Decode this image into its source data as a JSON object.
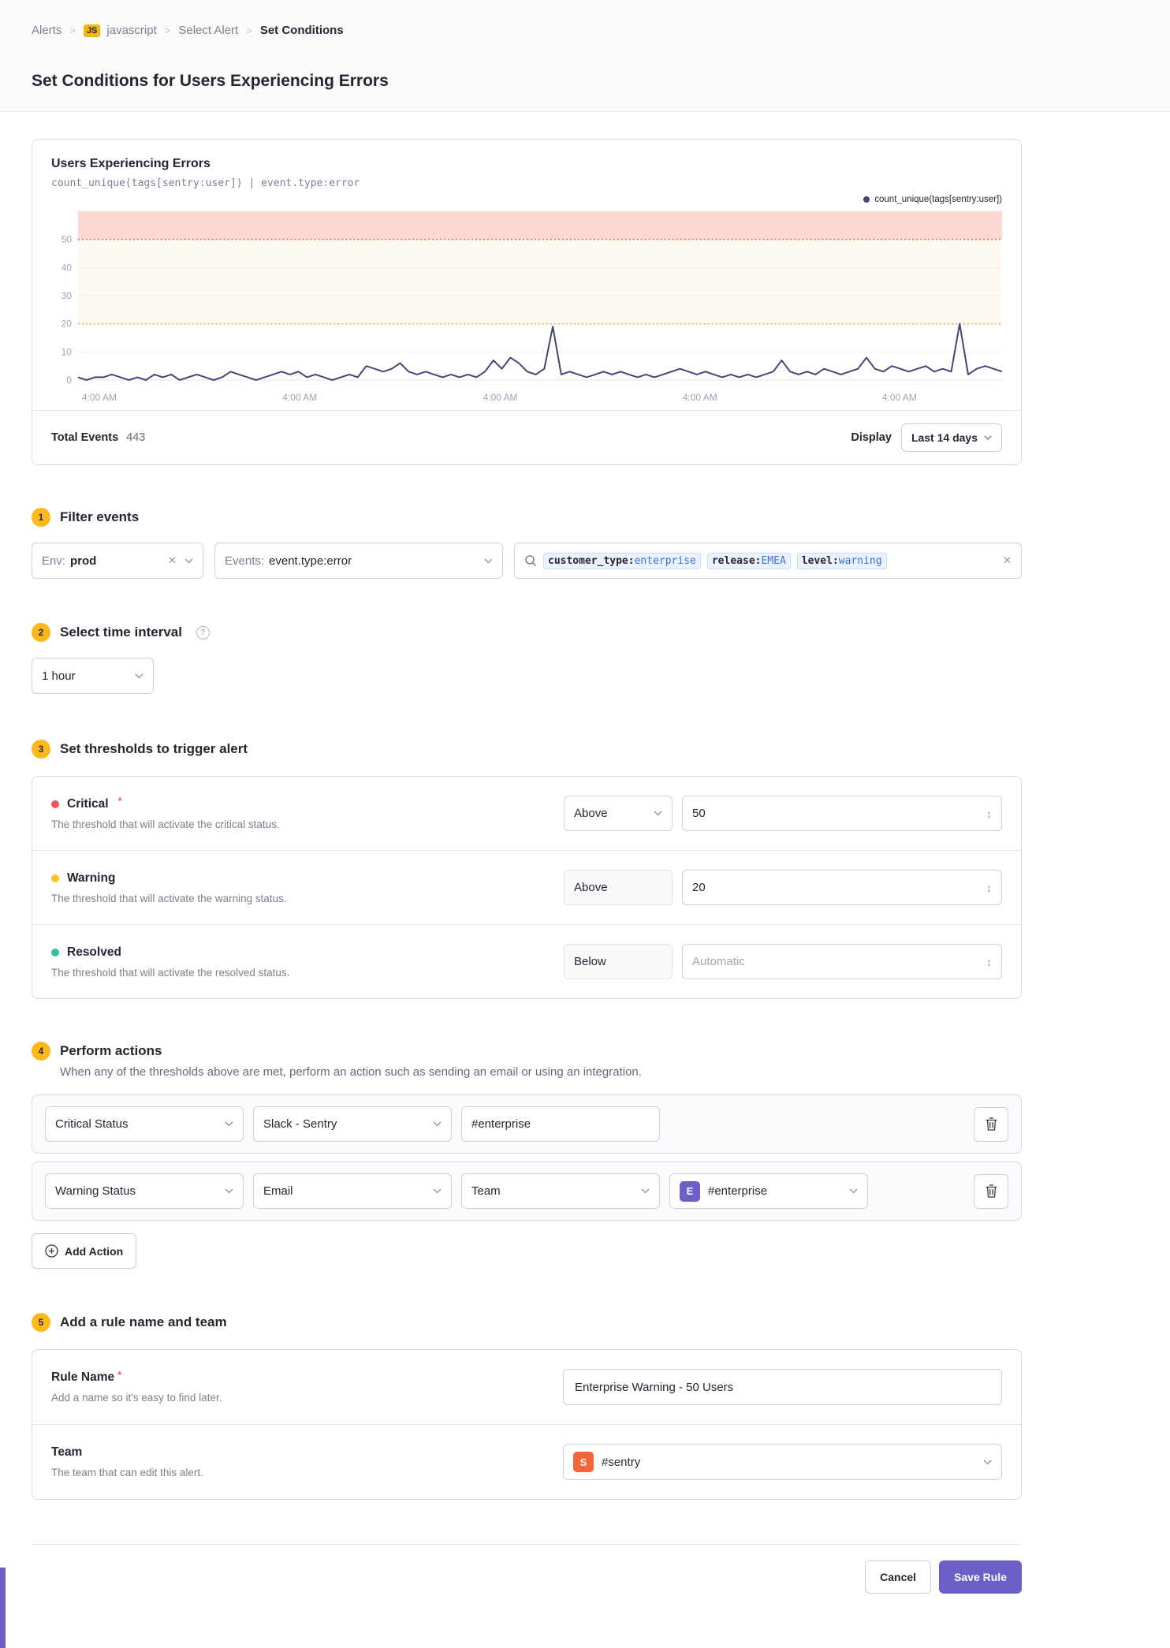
{
  "colors": {
    "accent": "#6C5FC7",
    "critical": "#f55459",
    "warning": "#ffc227",
    "resolved": "#33bf9e",
    "project_badge": "#edb813",
    "step_badge": "#fdb81b"
  },
  "icons": {
    "close": "✕",
    "stepper": "↕",
    "legend_dot": "●",
    "help": "?"
  },
  "breadcrumb": {
    "alerts": "Alerts",
    "project_badge": "JS",
    "project": "javascript",
    "select_alert": "Select Alert",
    "current": "Set Conditions",
    "separator": ">"
  },
  "page_title": "Set Conditions for Users Experiencing Errors",
  "chart_panel": {
    "title": "Users Experiencing Errors",
    "query": "count_unique(tags[sentry:user])  |  event.type:error",
    "legend": "count_unique(tags[sentry:user])",
    "total_events_label": "Total Events",
    "total_events_value": "443",
    "display_label": "Display",
    "display_value": "Last 14 days"
  },
  "chart_data": {
    "type": "line",
    "title": "Users Experiencing Errors",
    "ylabel": "",
    "xlabel": "",
    "ylim": [
      0,
      60
    ],
    "yticks": [
      0,
      10,
      20,
      30,
      40,
      50
    ],
    "x_labels": [
      "4:00 AM",
      "4:00 AM",
      "4:00 AM",
      "4:00 AM",
      "4:00 AM"
    ],
    "x_label_fractions": [
      0.023,
      0.24,
      0.457,
      0.673,
      0.889
    ],
    "grid": true,
    "legend_position": "top-right",
    "thresholds": {
      "critical": 50,
      "warning": 20
    },
    "band_colors": {
      "critical": "#fbd8d2",
      "warning": "#fffaf1"
    },
    "threshold_line_colors": {
      "critical": "#ee6358",
      "warning": "#f9a838"
    },
    "line_color": "#444674",
    "series": [
      {
        "name": "count_unique(tags[sentry:user])",
        "values": [
          1,
          0,
          1,
          1,
          2,
          1,
          0,
          1,
          0,
          2,
          1,
          2,
          0,
          1,
          2,
          1,
          0,
          1,
          3,
          2,
          1,
          0,
          1,
          2,
          3,
          2,
          3,
          1,
          2,
          1,
          0,
          1,
          2,
          1,
          5,
          4,
          3,
          4,
          6,
          3,
          2,
          3,
          2,
          1,
          2,
          1,
          2,
          1,
          3,
          7,
          4,
          8,
          6,
          3,
          2,
          4,
          19,
          2,
          3,
          2,
          1,
          2,
          3,
          2,
          3,
          2,
          1,
          2,
          1,
          2,
          3,
          4,
          3,
          2,
          3,
          2,
          1,
          2,
          1,
          2,
          1,
          2,
          3,
          7,
          3,
          2,
          3,
          2,
          4,
          3,
          2,
          3,
          4,
          8,
          4,
          3,
          5,
          4,
          3,
          4,
          5,
          3,
          4,
          3,
          20,
          2,
          4,
          5,
          4,
          3
        ]
      }
    ]
  },
  "filter": {
    "step": "1",
    "title": "Filter events",
    "env_label": "Env:",
    "env_value": "prod",
    "events_label": "Events:",
    "events_value": "event.type:error",
    "tokens": [
      {
        "key": "customer_type:",
        "value": "enterprise"
      },
      {
        "key": "release:",
        "value": "EMEA"
      },
      {
        "key": "level:",
        "value": "warning"
      }
    ]
  },
  "interval": {
    "step": "2",
    "title": "Select time interval",
    "value": "1 hour"
  },
  "thresholds": {
    "step": "3",
    "title": "Set thresholds to trigger alert",
    "rows": [
      {
        "label": "Critical",
        "required": "*",
        "desc": "The threshold that will activate the critical status.",
        "comparison": "Above",
        "value": "50"
      },
      {
        "label": "Warning",
        "desc": "The threshold that will activate the warning status.",
        "comparison": "Above",
        "value": "20"
      },
      {
        "label": "Resolved",
        "desc": "The threshold that will activate the resolved status.",
        "comparison": "Below",
        "placeholder": "Automatic"
      }
    ]
  },
  "actions": {
    "step": "4",
    "title": "Perform actions",
    "desc": "When any of the thresholds above are met, perform an action such as sending an email or using an integration.",
    "rows": [
      {
        "trigger": "Critical Status",
        "service": "Slack - Sentry",
        "target": "#enterprise"
      },
      {
        "trigger": "Warning Status",
        "service": "Email",
        "target_type": "Team",
        "team_badge": "E",
        "team": "#enterprise"
      }
    ],
    "add_label": "Add Action"
  },
  "naming": {
    "step": "5",
    "title": "Add a rule name and team",
    "rule_name": {
      "label": "Rule Name",
      "required": "*",
      "desc": "Add a name so it's easy to find later.",
      "value": "Enterprise Warning - 50 Users"
    },
    "team": {
      "label": "Team",
      "desc": "The team that can edit this alert.",
      "badge": "S",
      "value": "#sentry"
    }
  },
  "footer": {
    "cancel": "Cancel",
    "save": "Save Rule"
  }
}
